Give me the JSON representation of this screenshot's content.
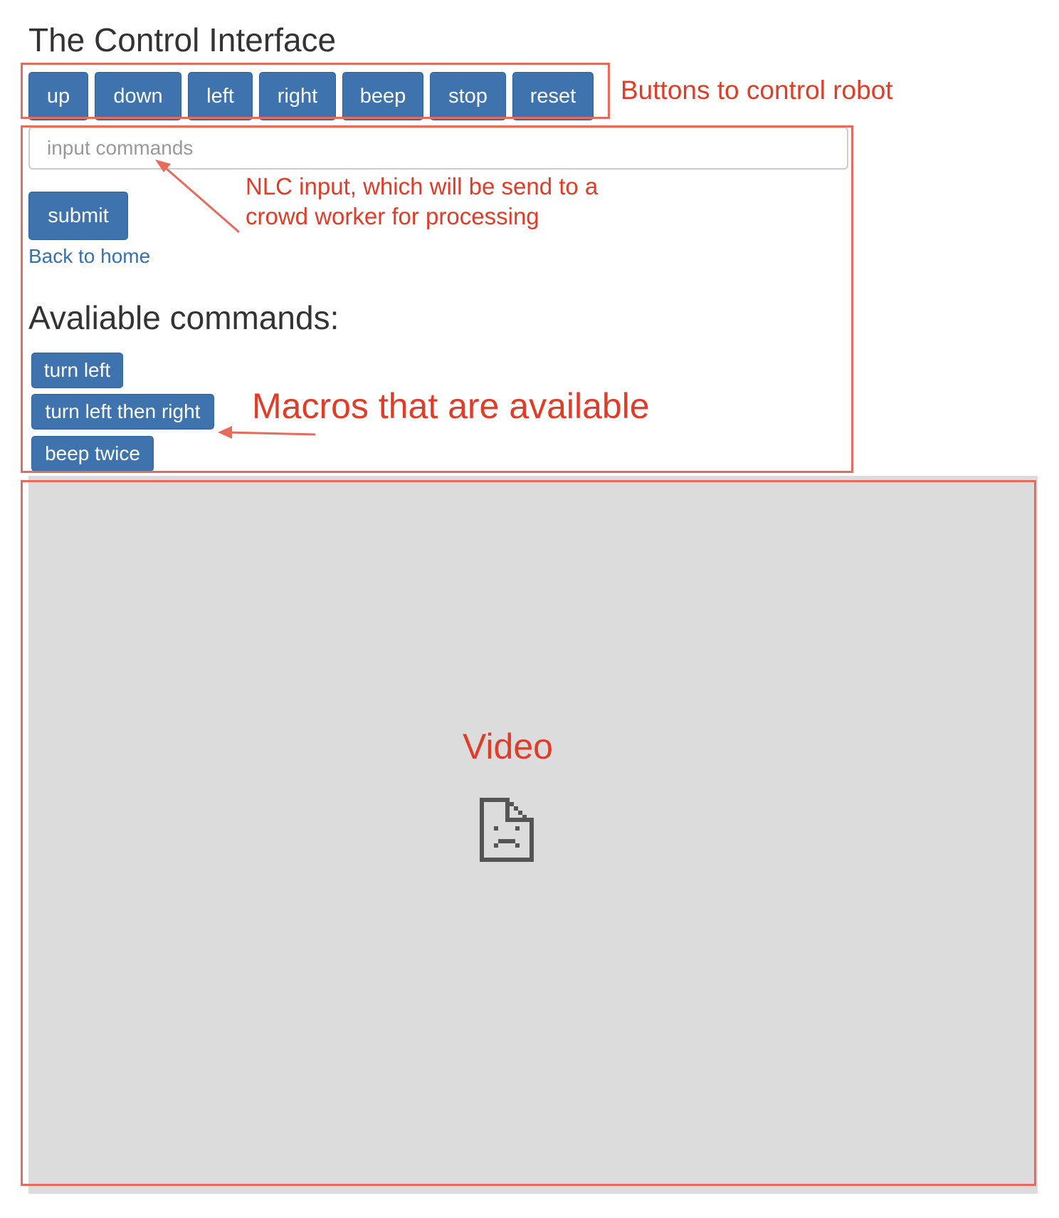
{
  "page": {
    "title": "The Control Interface"
  },
  "controls": {
    "buttons": [
      {
        "label": "up"
      },
      {
        "label": "down"
      },
      {
        "label": "left"
      },
      {
        "label": "right"
      },
      {
        "label": "beep"
      },
      {
        "label": "stop"
      },
      {
        "label": "reset"
      }
    ]
  },
  "command_form": {
    "input_placeholder": "input commands",
    "input_value": "",
    "submit_label": "submit",
    "back_link": "Back to home"
  },
  "macros": {
    "heading": "Avaliable commands:",
    "items": [
      {
        "label": "turn left"
      },
      {
        "label": "turn left then right"
      },
      {
        "label": "beep twice"
      }
    ]
  },
  "video": {
    "icon": "broken-document-icon"
  },
  "annotations": {
    "controls_note": "Buttons to control robot",
    "input_note_line1": "NLC input, which will be send to a",
    "input_note_line2": "crowd worker for processing",
    "macros_note": "Macros that are available",
    "video_note": "Video"
  },
  "colors": {
    "button_bg": "#3f73ad",
    "link": "#3570b0",
    "annotation": "#e86a5c",
    "annotation_text": "#e03c28",
    "video_bg": "#dcdcdc"
  }
}
